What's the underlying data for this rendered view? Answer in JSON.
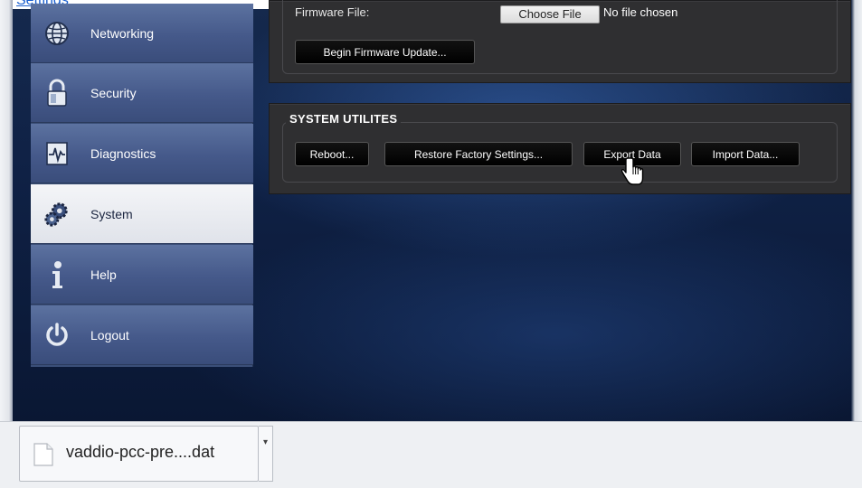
{
  "top_link": {
    "text": "Settings"
  },
  "sidebar": {
    "items": [
      {
        "label": "Networking",
        "icon": "globe-icon",
        "active": false
      },
      {
        "label": "Security",
        "icon": "lock-icon",
        "active": false
      },
      {
        "label": "Diagnostics",
        "icon": "diagnostics-icon",
        "active": false
      },
      {
        "label": "System",
        "icon": "gears-icon",
        "active": true
      },
      {
        "label": "Help",
        "icon": "info-icon",
        "active": false
      },
      {
        "label": "Logout",
        "icon": "power-icon",
        "active": false
      }
    ]
  },
  "firmware": {
    "label": "Firmware File:",
    "choose_file": "Choose File",
    "no_file": "No file chosen",
    "begin_button": "Begin Firmware Update..."
  },
  "utilities": {
    "title": "SYSTEM UTILITES",
    "buttons": {
      "reboot": "Reboot...",
      "restore": "Restore Factory Settings...",
      "export": "Export Data",
      "import": "Import Data..."
    }
  },
  "download_bar": {
    "filename": "vaddio-pcc-pre....dat",
    "menu_icon": "caret-down-icon"
  }
}
